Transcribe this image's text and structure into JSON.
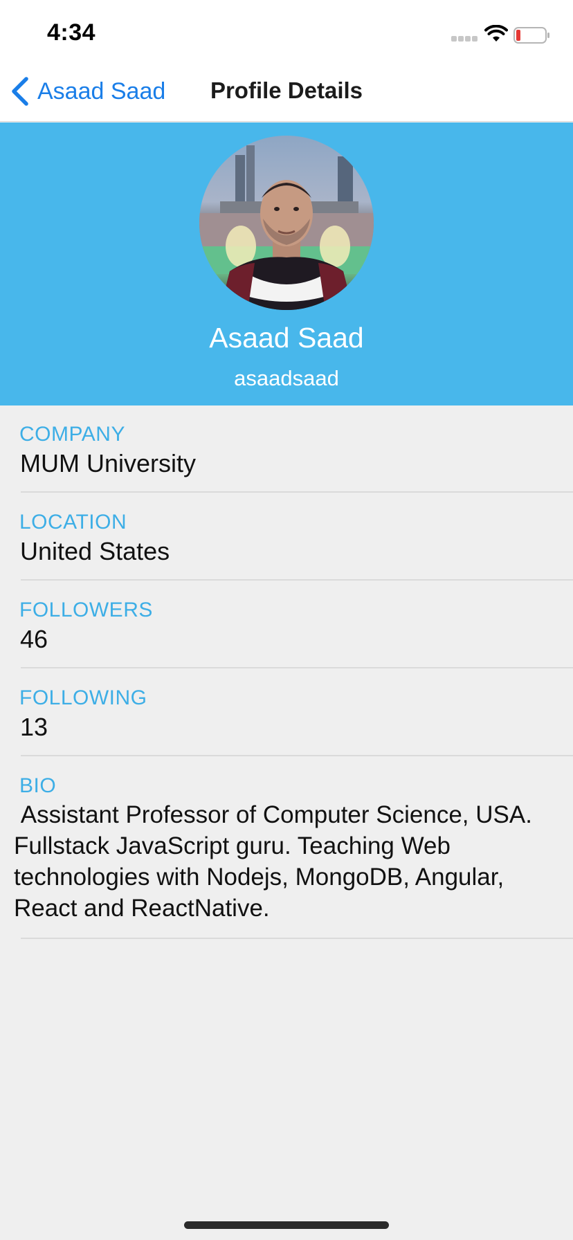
{
  "status_bar": {
    "time": "4:34",
    "signal_icon": "cellular-signal-icon",
    "wifi_icon": "wifi-icon",
    "battery_icon": "battery-icon",
    "battery_color": "#e53935"
  },
  "nav": {
    "back_label": "Asaad Saad",
    "back_icon": "chevron-left-icon",
    "title": "Profile Details",
    "accent_color": "#1a7ee8"
  },
  "header": {
    "background_color": "#48b7eb",
    "name": "Asaad Saad",
    "username": "asaadsaad"
  },
  "details": {
    "company": {
      "label": "COMPANY",
      "value": "MUM University"
    },
    "location": {
      "label": "LOCATION",
      "value": "United States"
    },
    "followers": {
      "label": "FOLLOWERS",
      "value": "46"
    },
    "following": {
      "label": "FOLLOWING",
      "value": "13"
    },
    "bio": {
      "label": "BIO",
      "value": " Assistant Professor of Computer Science, USA. Fullstack JavaScript guru. Teaching Web technologies with Nodejs, MongoDB, Angular, React and ReactNative."
    }
  }
}
